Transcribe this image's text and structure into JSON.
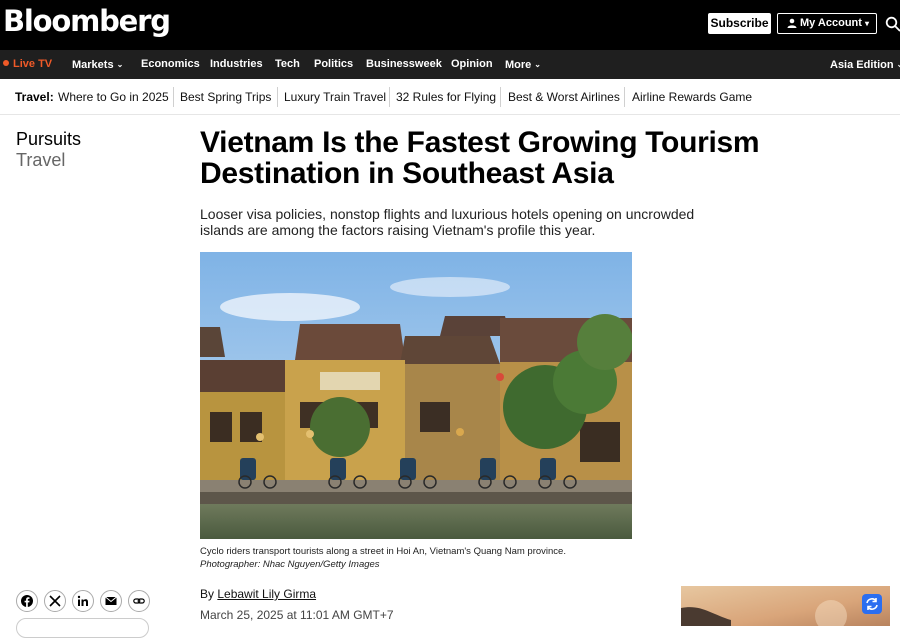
{
  "header": {
    "logo": "Bloomberg",
    "subscribe_label": "Subscribe",
    "account_label": "My Account",
    "account_caret": "▾"
  },
  "nav": {
    "items": [
      {
        "label": "Live TV"
      },
      {
        "label": "Markets"
      },
      {
        "label": "Economics"
      },
      {
        "label": "Industries"
      },
      {
        "label": "Tech"
      },
      {
        "label": "Politics"
      },
      {
        "label": "Businessweek"
      },
      {
        "label": "Opinion"
      },
      {
        "label": "More"
      },
      {
        "label": "Asia Edition"
      }
    ],
    "chevron": "⌄"
  },
  "travel_strip": {
    "label": "Travel:",
    "links": [
      "Where to Go in 2025",
      "Best Spring Trips",
      "Luxury Train Travel",
      "32 Rules for Flying",
      "Best & Worst Airlines",
      "Airline Rewards Game"
    ]
  },
  "rail": {
    "section": "Pursuits",
    "subsection": "Travel"
  },
  "article": {
    "headline": "Vietnam Is the Fastest Growing Tourism Destination in Southeast Asia",
    "dek": "Looser visa policies, nonstop flights and luxurious hotels opening on uncrowded islands are among the factors raising Vietnam's profile this year.",
    "caption": "Cyclo riders transport tourists along a street in Hoi An, Vietnam's Quang Nam province.",
    "credit": "Photographer: Nhac Nguyen/Getty Images",
    "byline_prefix": "By",
    "author": "Lebawit Lily Girma",
    "date": "March 25, 2025 at 11:01 AM GMT+7"
  },
  "colors": {
    "live_accent": "#f05a28",
    "promo_button": "#2b6ef0"
  },
  "share_icons": [
    "facebook-icon",
    "x-icon",
    "linkedin-icon",
    "email-icon",
    "link-icon"
  ]
}
